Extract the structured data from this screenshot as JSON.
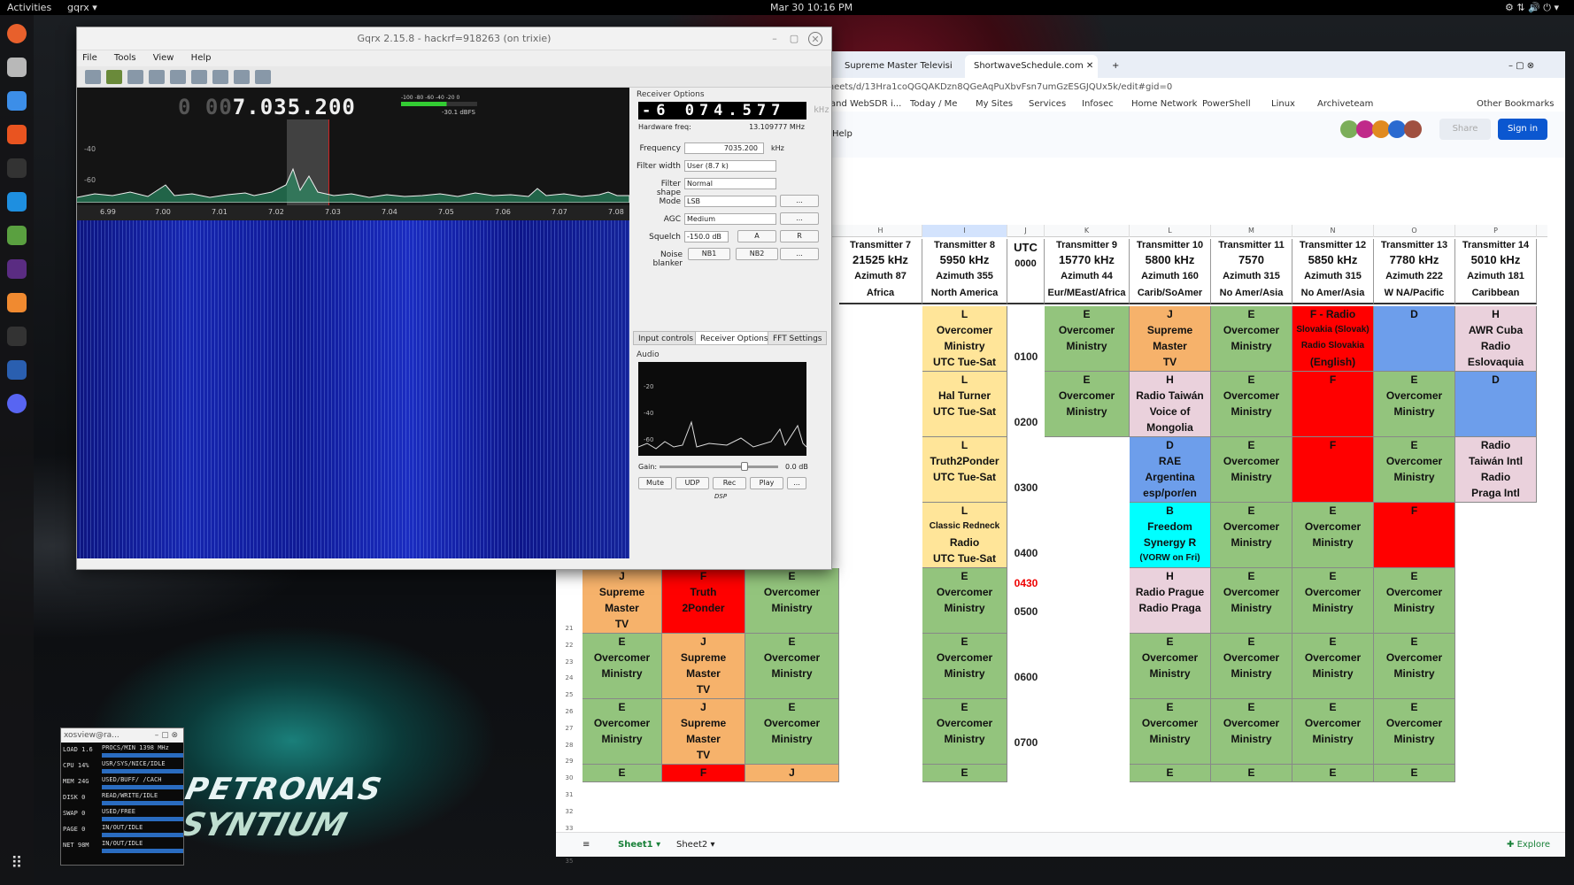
{
  "topbar": {
    "activities": "Activities",
    "app": "gqrx ▾",
    "clock": "Mar 30  10:16 PM"
  },
  "gqrx": {
    "title": "Gqrx 2.15.8 - hackrf=918263 (on trixie)",
    "menu": [
      "File",
      "Tools",
      "View",
      "Help"
    ],
    "freq_dim": "0 00",
    "freq": "7.035.200",
    "dbfs": "-30.1 dBFS",
    "meter_ticks": [
      "-100",
      "-80",
      "-60",
      "-40",
      "-20",
      "0"
    ],
    "y_ticks": [
      "-40",
      "-60"
    ],
    "x_ticks": [
      "6.99",
      "7.00",
      "7.01",
      "7.02",
      "7.03",
      "7.04",
      "7.05",
      "7.06",
      "7.07",
      "7.08"
    ]
  },
  "rx": {
    "title": "Receiver Options",
    "freq": "-6 074.577",
    "unit": "kHz",
    "hw_label": "Hardware freq:",
    "hw_value": "13.109777 MHz",
    "frequency_label": "Frequency",
    "frequency": "7035.200",
    "frequency_unit": "kHz",
    "filter_width_label": "Filter width",
    "filter_width": "User (8.7 k)",
    "filter_shape_label": "Filter shape",
    "filter_shape": "Normal",
    "mode_label": "Mode",
    "mode": "LSB",
    "agc_label": "AGC",
    "agc": "Medium",
    "squelch_label": "Squelch",
    "squelch": "-150.0 dB",
    "btn_a": "A",
    "btn_r": "R",
    "nb_label": "Noise blanker",
    "nb1": "NB1",
    "nb2": "NB2",
    "more": "...",
    "tabs": [
      "Input controls",
      "Receiver Options",
      "FFT Settings"
    ]
  },
  "audio": {
    "title": "Audio",
    "y_ticks": [
      "-20",
      "-40",
      "-60"
    ],
    "gain_label": "Gain:",
    "gain": "0.0 dB",
    "buttons": [
      "Mute",
      "UDP",
      "Rec",
      "Play",
      "..."
    ],
    "dsp": "DSP"
  },
  "xosview": {
    "title": "xosview@ra...",
    "rows": [
      {
        "k": "LOAD",
        "v": "1.6",
        "d": "PROCS/MIN 1398 MHz"
      },
      {
        "k": "CPU",
        "v": "14%",
        "d": "USR/SYS/NICE/IDLE"
      },
      {
        "k": "MEM",
        "v": "24G",
        "d": "USED/BUFF/ /CACH"
      },
      {
        "k": "DISK",
        "v": "0",
        "d": "READ/WRITE/IDLE"
      },
      {
        "k": "SWAP",
        "v": "0",
        "d": "USED/FREE"
      },
      {
        "k": "PAGE",
        "v": "0",
        "d": "IN/OUT/IDLE"
      },
      {
        "k": "NET",
        "v": "98M",
        "d": "IN/OUT/IDLE"
      }
    ]
  },
  "browser": {
    "tabs": [
      "Supreme Master Televisi",
      "ShortwaveSchedule.com"
    ],
    "url": "readsheets/d/13Hra1coQGQAKDzn8QGeAqPuXbvFsn7umGzESGJQUx5k/edit#gid=0",
    "bookmarks": [
      "and WebSDR i...",
      "Today / Me",
      "My Sites",
      "Services",
      "Infosec",
      "Home Network",
      "PowerShell",
      "Linux",
      "Archiveteam",
      "Other Bookmarks"
    ],
    "menu_help": "Help",
    "menu_ns": "ns",
    "share": "Share",
    "signin": "Sign in",
    "cols": [
      "H",
      "I",
      "J",
      "K",
      "L",
      "M",
      "N",
      "O",
      "P"
    ],
    "sheets": [
      "Sheet1",
      "Sheet2"
    ],
    "explore": "Explore"
  },
  "schedule": {
    "headers": [
      {
        "l1": "Transmitter 7",
        "l2": "21525 kHz",
        "l3": "Azimuth 87",
        "l4": "Africa"
      },
      {
        "l1": "Transmitter 8",
        "l2": "5950 kHz",
        "l3": "Azimuth 355",
        "l4": "North America"
      },
      {
        "l1": "",
        "l2": "UTC",
        "l3": "0000",
        "l4": ""
      },
      {
        "l1": "Transmitter 9",
        "l2": "15770 kHz",
        "l3": "Azimuth 44",
        "l4": "Eur/MEast/Africa"
      },
      {
        "l1": "Transmitter 10",
        "l2": "5800 kHz",
        "l3": "Azimuth 160",
        "l4": "Carib/SoAmer"
      },
      {
        "l1": "Transmitter 11",
        "l2": "7570",
        "l3": "Azimuth 315",
        "l4": "No Amer/Asia"
      },
      {
        "l1": "Transmitter 12",
        "l2": "5850 kHz",
        "l3": "Azimuth 315",
        "l4": "No Amer/Asia"
      },
      {
        "l1": "Transmitter 13",
        "l2": "7780 kHz",
        "l3": "Azimuth 222",
        "l4": "W NA/Pacific"
      },
      {
        "l1": "Transmitter 14",
        "l2": "5010 kHz",
        "l3": "Azimuth 181",
        "l4": "Caribbean"
      }
    ],
    "utc": [
      "0100",
      "0200",
      "0300",
      "0400",
      "0430",
      "0500",
      "0600",
      "0700"
    ],
    "row_numbers": [
      "21",
      "22",
      "23",
      "24",
      "25",
      "26",
      "27",
      "28",
      "29",
      "30",
      "31",
      "32",
      "33",
      "34",
      "35"
    ]
  }
}
